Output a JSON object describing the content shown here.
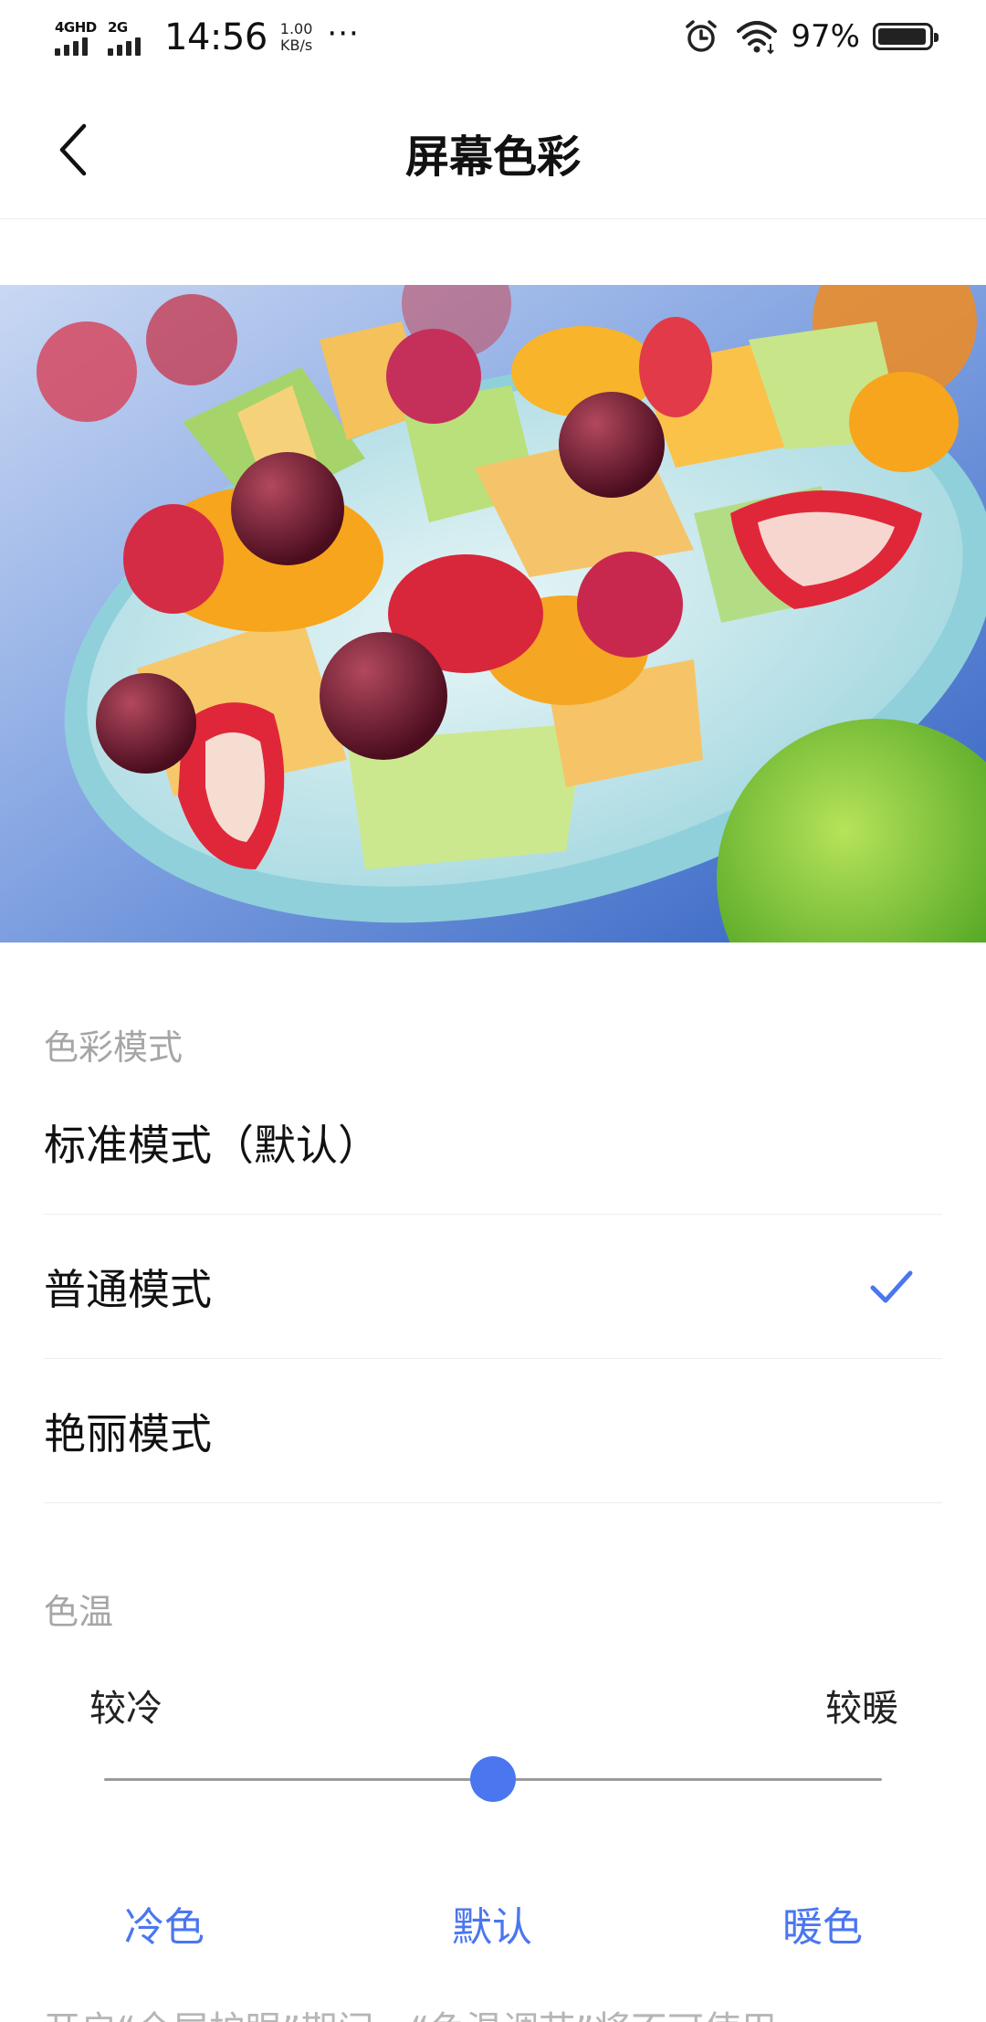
{
  "status_bar": {
    "signal_1_label": "4GHD",
    "signal_2_label": "2G",
    "time": "14:56",
    "speed_value": "1.00",
    "speed_unit": "KB/s",
    "more": "···",
    "battery_percent": "97%",
    "battery_level": 0.97
  },
  "header": {
    "title": "屏幕色彩"
  },
  "preview": {
    "subject": "fruit-salad-bowl"
  },
  "color_mode": {
    "section_label": "色彩模式",
    "options": [
      {
        "label": "标准模式（默认）",
        "selected": false
      },
      {
        "label": "普通模式",
        "selected": true
      },
      {
        "label": "艳丽模式",
        "selected": false
      }
    ]
  },
  "color_temp": {
    "section_label": "色温",
    "cold_label": "较冷",
    "warm_label": "较暖",
    "slider_value": 0.5,
    "presets": {
      "cool": "冷色",
      "default": "默认",
      "warm": "暖色"
    }
  },
  "footer": {
    "note": "开启“全屏护眼”期间，“色温调节”将不可使用"
  },
  "colors": {
    "accent": "#4a76f0",
    "section_label": "#a6a6a6"
  }
}
